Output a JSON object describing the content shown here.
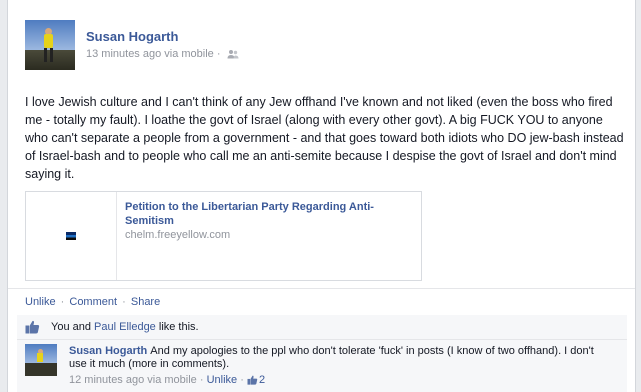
{
  "post": {
    "author": "Susan Hogarth",
    "timestamp": "13 minutes ago via mobile ·",
    "privacy_icon": "people-icon",
    "text": "I love Jewish culture and I can't think of any Jew offhand I've known and not liked (even the boss who fired me - totally my fault). I loathe the govt of Israel (along with every other govt). A big FUCK YOU to anyone who can't separate a people from a government - and that goes toward both idiots who DO jew-bash instead of Israel-bash and to people who call me an anti-semite because I despise the govt of Israel and don't mind saying it."
  },
  "share": {
    "title": "Petition to the Libertarian Party Regarding Anti-Semitism",
    "domain": "chelm.freeyellow.com"
  },
  "actions": {
    "unlike": "Unlike",
    "comment": "Comment",
    "share": "Share",
    "separator": "·"
  },
  "likes": {
    "you": "You",
    "and": " and ",
    "other": "Paul Elledge",
    "suffix": " like this."
  },
  "comment": {
    "author": "Susan Hogarth",
    "text": "And my apologies to the ppl who don't tolerate 'fuck' in posts (I know of two offhand). I don't use it much (more in comments).",
    "timestamp": "12 minutes ago via mobile ·",
    "unlike": "Unlike",
    "separator": "·",
    "like_count": "2"
  },
  "colors": {
    "link": "#3b5998",
    "muted": "#90949c",
    "ufi_bg": "#f6f7f9"
  }
}
